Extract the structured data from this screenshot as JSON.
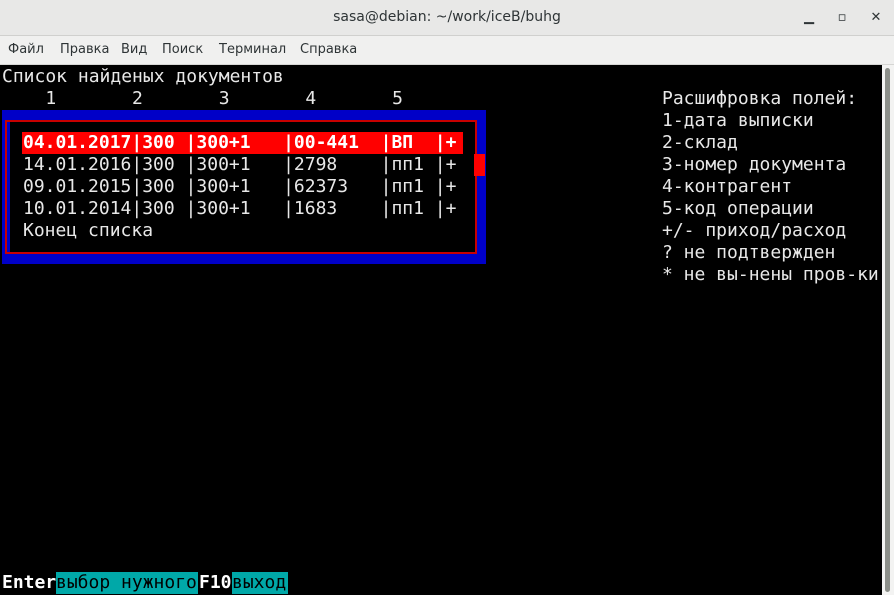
{
  "window": {
    "title": "sasa@debian: ~/work/iceB/buhg"
  },
  "menu": [
    "Файл",
    "Правка",
    "Вид",
    "Поиск",
    "Терминал",
    "Справка"
  ],
  "screen": {
    "heading": "Список найденых документов",
    "column_numbers": "    1       2       3       4       5",
    "rows": [
      "04.01.2017|300 |300+1   |00-441  |ВП  |+",
      "14.01.2016|300 |300+1   |2798    |пп1 |+",
      "09.01.2015|300 |300+1   |62373   |пп1 |+",
      "10.01.2014|300 |300+1   |1683    |пп1 |+"
    ],
    "end_of_list": "Конец списка",
    "legend": [
      "Расшифровка полей:",
      "1-дата выписки",
      "2-склад",
      "3-номер документа",
      "4-контрагент",
      "5-код операции",
      "+/- приход/расход",
      "? не подтвержден",
      "* не вы-нены пров-ки"
    ]
  },
  "footer": [
    {
      "key": "Enter",
      "action": "выбор нужного"
    },
    {
      "key": "F10",
      "action": "выход"
    }
  ],
  "colors": {
    "selection": "#ff0000",
    "frame": "#0000c8",
    "border": "#c80000",
    "hint": "#00a8a8"
  }
}
